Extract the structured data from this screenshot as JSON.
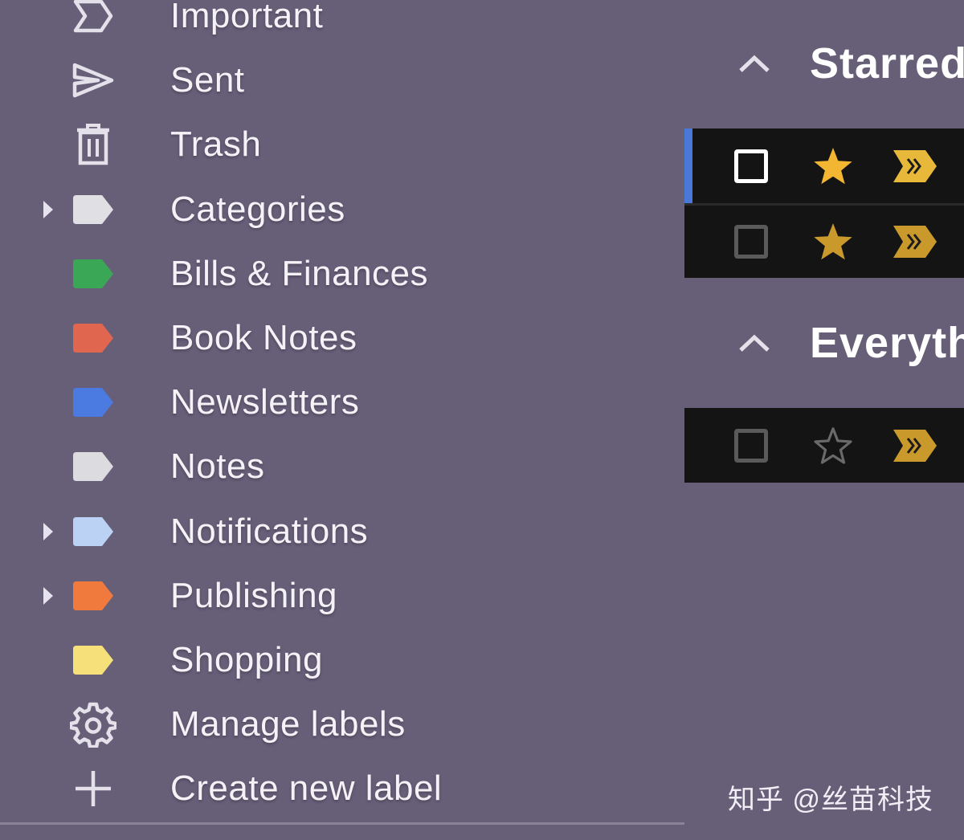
{
  "sidebar": {
    "items": [
      {
        "label": "Important",
        "icon": "important-icon",
        "expandable": false
      },
      {
        "label": "Sent",
        "icon": "send-icon",
        "expandable": false
      },
      {
        "label": "Trash",
        "icon": "trash-icon",
        "expandable": false
      },
      {
        "label": "Categories",
        "icon": "label-icon",
        "color": "#e0dfe4",
        "expandable": true
      },
      {
        "label": "Bills & Finances",
        "icon": "label-icon",
        "color": "#3aa757",
        "expandable": false
      },
      {
        "label": "Book Notes",
        "icon": "label-icon",
        "color": "#e06650",
        "expandable": false
      },
      {
        "label": "Newsletters",
        "icon": "label-icon",
        "color": "#4b7ae0",
        "expandable": false
      },
      {
        "label": "Notes",
        "icon": "label-icon",
        "color": "#dcdbe0",
        "expandable": false
      },
      {
        "label": "Notifications",
        "icon": "label-icon",
        "color": "#bcd2f5",
        "expandable": true
      },
      {
        "label": "Publishing",
        "icon": "label-icon",
        "color": "#f07a3e",
        "expandable": true
      },
      {
        "label": "Shopping",
        "icon": "label-icon",
        "color": "#f5e07a",
        "expandable": false
      },
      {
        "label": "Manage labels",
        "icon": "gear-icon",
        "expandable": false
      },
      {
        "label": "Create new label",
        "icon": "plus-icon",
        "expandable": false
      }
    ]
  },
  "main": {
    "sections": [
      {
        "title": "Starred",
        "collapse_icon": "chevron-up-icon",
        "rows": [
          {
            "checked": false,
            "focused": true,
            "starred": true,
            "important": true
          },
          {
            "checked": false,
            "focused": false,
            "starred": true,
            "important": true
          }
        ]
      },
      {
        "title": "Everyth",
        "collapse_icon": "chevron-up-icon",
        "rows": [
          {
            "checked": false,
            "focused": false,
            "starred": false,
            "important": true
          }
        ]
      }
    ]
  },
  "colors": {
    "background": "#675e78",
    "star": "#f2b632",
    "important": "#e7b83a",
    "selection_bar": "#4a78d8"
  },
  "watermark": {
    "text": "知乎 @丝苗科技"
  }
}
